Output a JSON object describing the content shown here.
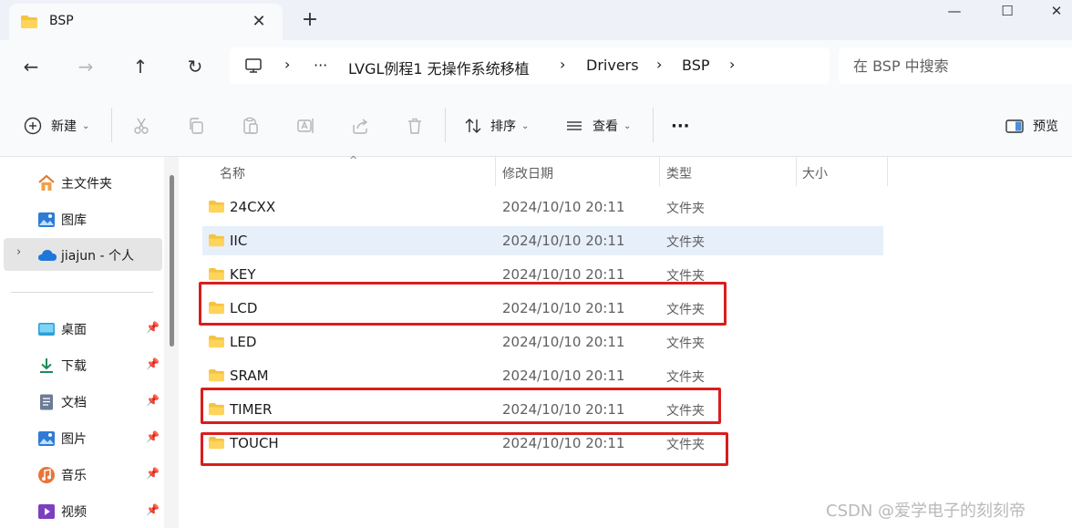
{
  "window": {
    "tab_title": "BSP",
    "tab_close": "✕",
    "new_tab": "+",
    "minimize": "—",
    "maximize": "☐",
    "close": "✕"
  },
  "nav": {
    "back": "←",
    "forward": "→",
    "up": "↑",
    "refresh": "↻"
  },
  "address": {
    "sep": "›",
    "overflow": "···",
    "crumbs": [
      "LVGL例程1 无操作系统移植",
      "Drivers",
      "BSP"
    ]
  },
  "search": {
    "placeholder": "在 BSP 中搜索"
  },
  "toolbar": {
    "new_label": "新建",
    "sort_label": "排序",
    "view_label": "查看",
    "more_label": "···",
    "preview_label": "预览",
    "chevron": "⌄"
  },
  "sidebar": {
    "expand": "›",
    "pin": "📌",
    "items": [
      {
        "label": "主文件夹"
      },
      {
        "label": "图库"
      },
      {
        "label": "jiajun - 个人"
      },
      {
        "label": "桌面"
      },
      {
        "label": "下载"
      },
      {
        "label": "文档"
      },
      {
        "label": "图片"
      },
      {
        "label": "音乐"
      },
      {
        "label": "视频"
      }
    ]
  },
  "columns": {
    "name": "名称",
    "modified": "修改日期",
    "type": "类型",
    "size": "大小",
    "sort_indicator": "^"
  },
  "files": [
    {
      "name": "24CXX",
      "modified": "2024/10/10 20:11",
      "type": "文件夹"
    },
    {
      "name": "IIC",
      "modified": "2024/10/10 20:11",
      "type": "文件夹"
    },
    {
      "name": "KEY",
      "modified": "2024/10/10 20:11",
      "type": "文件夹"
    },
    {
      "name": "LCD",
      "modified": "2024/10/10 20:11",
      "type": "文件夹"
    },
    {
      "name": "LED",
      "modified": "2024/10/10 20:11",
      "type": "文件夹"
    },
    {
      "name": "SRAM",
      "modified": "2024/10/10 20:11",
      "type": "文件夹"
    },
    {
      "name": "TIMER",
      "modified": "2024/10/10 20:11",
      "type": "文件夹"
    },
    {
      "name": "TOUCH",
      "modified": "2024/10/10 20:11",
      "type": "文件夹"
    }
  ],
  "colors": {
    "highlight": "#d81e1e",
    "hover_row": "#e7f0fa",
    "folder": "#f5c342"
  },
  "watermark": "CSDN @爱学电子的刻刻帝"
}
